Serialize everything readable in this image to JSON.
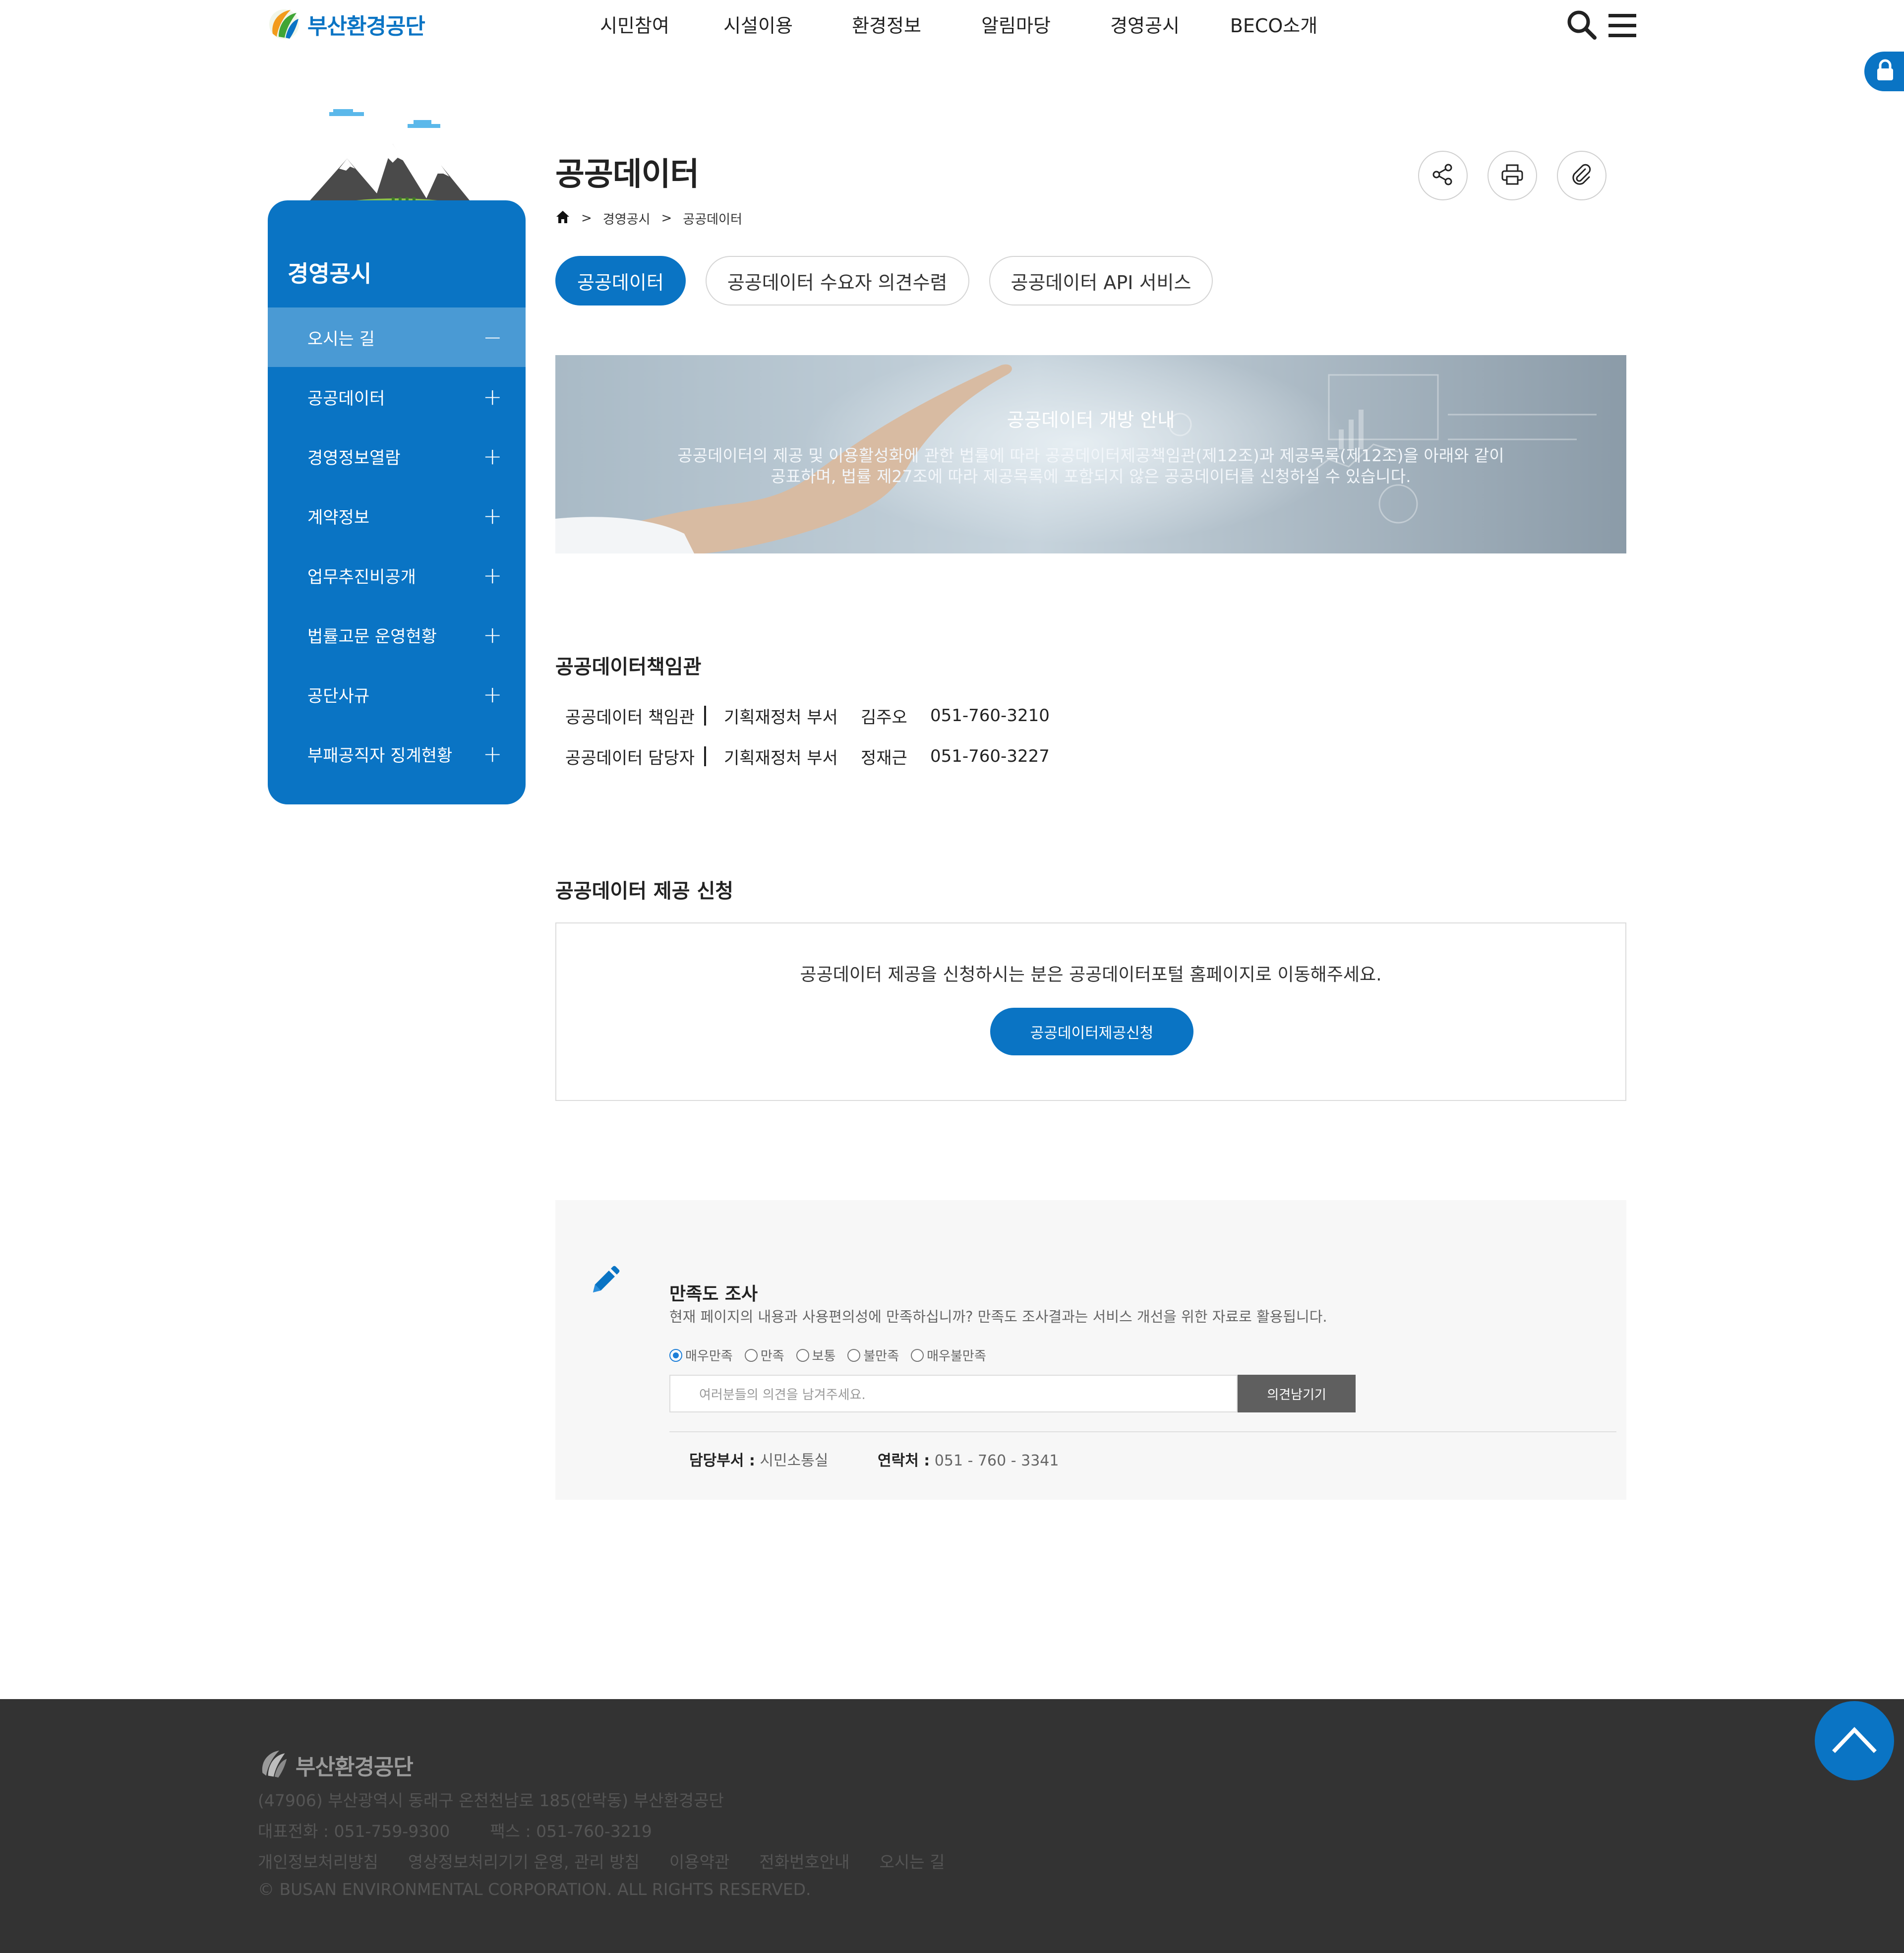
{
  "header": {
    "logo_text": "부산환경공단",
    "nav": [
      "시민참여",
      "시설이용",
      "환경정보",
      "알림마당",
      "경영공시",
      "BECO소개"
    ]
  },
  "sidebar": {
    "title": "경영공시",
    "items": [
      {
        "label": "오시는 길",
        "sign": "−"
      },
      {
        "label": "공공데이터",
        "sign": "+"
      },
      {
        "label": "경영정보열람",
        "sign": "+"
      },
      {
        "label": "계약정보",
        "sign": "+"
      },
      {
        "label": "업무추진비공개",
        "sign": "+"
      },
      {
        "label": "법률고문 운영현황",
        "sign": "+"
      },
      {
        "label": "공단사규",
        "sign": "+"
      },
      {
        "label": "부패공직자 징계현황",
        "sign": "+"
      }
    ]
  },
  "content": {
    "page_title": "공공데이터",
    "breadcrumb": [
      "경영공시",
      "공공데이터"
    ],
    "breadcrumb_sep": ">",
    "tabs": [
      "공공데이터",
      "공공데이터 수요자 의견수렴",
      "공공데이터 API 서비스"
    ],
    "banner": {
      "title": "공공데이터 개방 안내",
      "desc_line1": "공공데이터의 제공 및 이용활성화에 관한 법률에 따라 공공데이터제공책임관(제12조)과 제공목록(제12조)을 아래와 같이",
      "desc_line2": "공표하며, 법률 제27조에 따라 제공목록에 포함되지 않은 공공데이터를 신청하실 수 있습니다."
    },
    "officer_section": {
      "title": "공공데이터책임관",
      "rows": [
        {
          "role": "공공데이터 책임관",
          "dept": "기획재정처 부서",
          "name": "김주오",
          "phone": "051-760-3210"
        },
        {
          "role": "공공데이터 담당자",
          "dept": "기획재정처 부서",
          "name": "정재근",
          "phone": "051-760-3227"
        }
      ]
    },
    "apply_section": {
      "title": "공공데이터 제공 신청",
      "message": "공공데이터 제공을 신청하시는 분은 공공데이터포털 홈페이지로 이동해주세요.",
      "button": "공공데이터제공신청"
    },
    "survey": {
      "title": "만족도 조사",
      "desc": "현재 페이지의 내용과 사용편의성에 만족하십니까? 만족도 조사결과는 서비스 개선을 위한 자료로 활용됩니다.",
      "options": [
        "매우만족",
        "만족",
        "보통",
        "불만족",
        "매우불만족"
      ],
      "selected": "매우만족",
      "placeholder": "여러분들의 의견을 남겨주세요.",
      "submit": "의견남기기",
      "dept_label": "담당부서 :",
      "dept_value": "시민소통실",
      "contact_label": "연락처 :",
      "contact_value": "051 - 760 - 3341"
    }
  },
  "footer": {
    "logo_text": "부산환경공단",
    "address": "(47906) 부산광역시 동래구 온천천남로 185(안락동) 부산환경공단",
    "tel": "대표전화 : 051-759-9300",
    "fax": "팩스 : 051-760-3219",
    "links": [
      "개인정보처리방침",
      "영상정보처리기기 운영, 관리 방침",
      "이용약관",
      "전화번호안내",
      "오시는 길"
    ],
    "copyright": "© BUSAN ENVIRONMENTAL CORPORATION. ALL RIGHTS RESERVED."
  },
  "colors": {
    "primary": "#0a74c4",
    "sidebar_active": "#4a9ad4",
    "footer_bg": "#333333",
    "survey_bg": "#f7f7f7"
  },
  "icons": {
    "toolbar": [
      "share-icon",
      "print-icon",
      "attach-icon"
    ],
    "header": [
      "search-icon",
      "menu-icon"
    ],
    "side": [
      "lock-icon"
    ],
    "survey": [
      "pencil-icon"
    ],
    "float": [
      "scroll-top-icon"
    ],
    "breadcrumb": [
      "home-icon"
    ]
  }
}
